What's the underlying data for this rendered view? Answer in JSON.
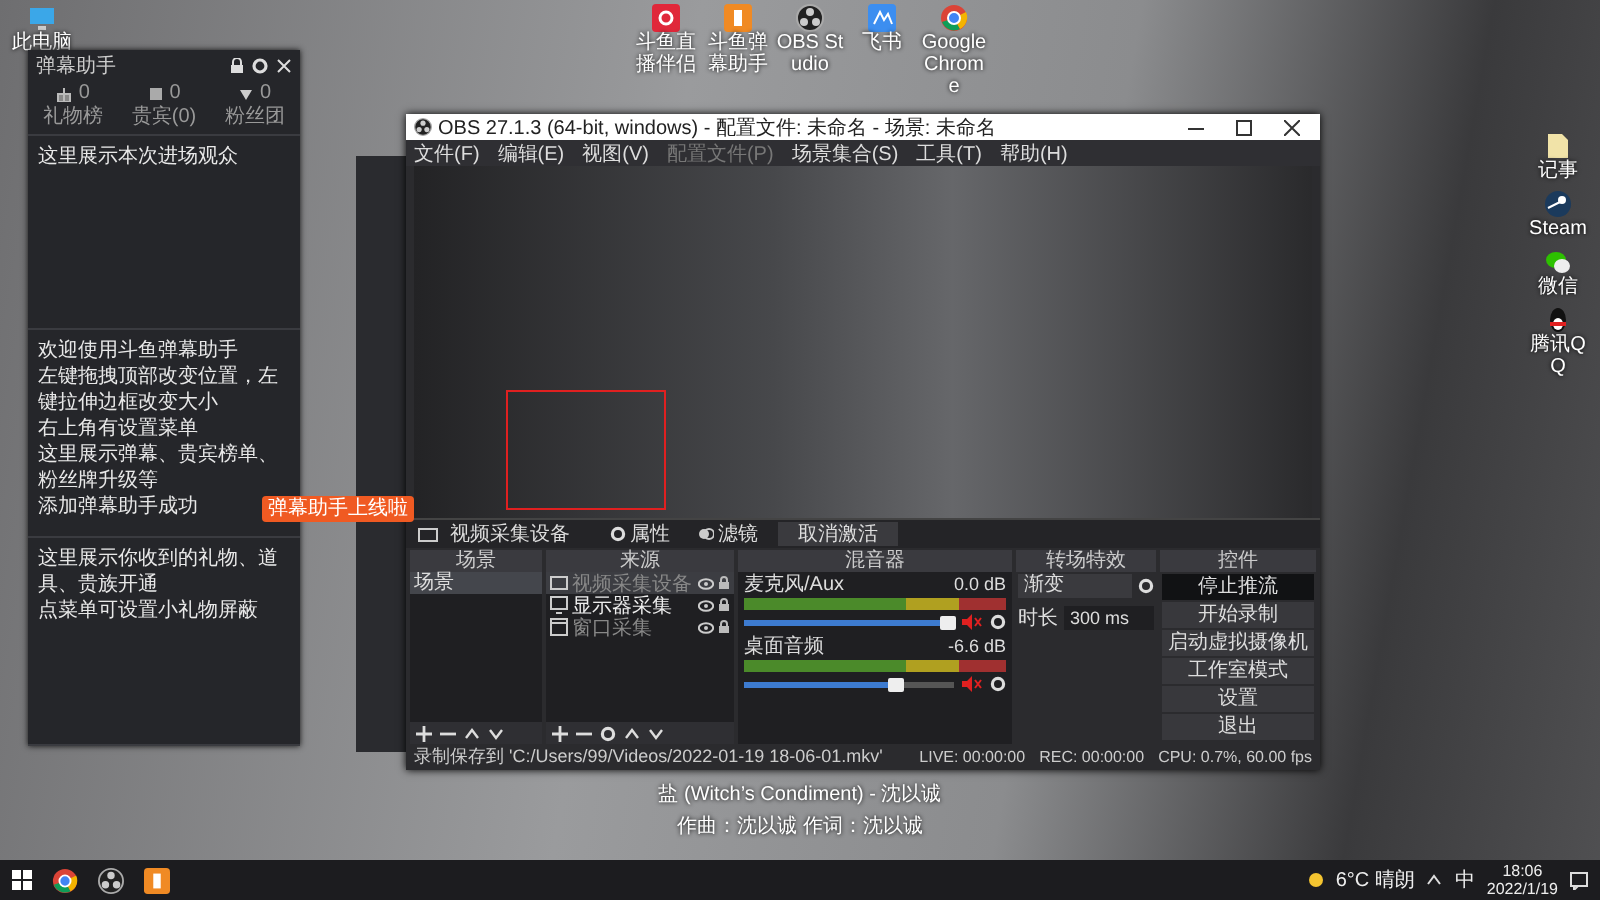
{
  "desktop": {
    "left_icons": [
      {
        "label": "此电脑",
        "kind": "pc"
      }
    ],
    "top_icons": [
      {
        "label": "斗鱼直播伴侣",
        "kind": "red"
      },
      {
        "label": "斗鱼弹幕助手",
        "kind": "orange"
      },
      {
        "label": "OBS Studio",
        "kind": "obs"
      },
      {
        "label": "飞书",
        "kind": "blue"
      },
      {
        "label": "Google Chrome",
        "kind": "chrome"
      }
    ],
    "right_icons": [
      {
        "label": "记事",
        "kind": "file"
      },
      {
        "label": "Steam",
        "kind": "steam"
      },
      {
        "label": "微信",
        "kind": "wechat"
      },
      {
        "label": "腾讯QQ",
        "kind": "qq"
      }
    ]
  },
  "helper_window": {
    "title": "弹幕助手",
    "stats": [
      {
        "count": "0",
        "label": "礼物榜"
      },
      {
        "count": "0",
        "label": "贵宾(0)"
      },
      {
        "count": "0",
        "label": "粉丝团"
      }
    ],
    "sections": [
      {
        "lines": [
          "这里展示本次进场观众"
        ]
      },
      {
        "lines": [
          "欢迎使用斗鱼弹幕助手",
          "左键拖拽顶部改变位置，左键拉伸边框改变大小",
          "右上角有设置菜单",
          "这里展示弹幕、贵宾榜单、粉丝牌升级等",
          "添加弹幕助手成功"
        ]
      },
      {
        "lines": [
          "这里展示你收到的礼物、道具、贵族开通",
          "点菜单可设置小礼物屏蔽"
        ]
      }
    ]
  },
  "tooltip": {
    "text": "弹幕助手上线啦"
  },
  "obs": {
    "title": "OBS 27.1.3 (64-bit, windows) - 配置文件: 未命名 - 场景: 未命名",
    "menu": [
      {
        "label": "文件(F)",
        "disabled": false
      },
      {
        "label": "编辑(E)",
        "disabled": false
      },
      {
        "label": "视图(V)",
        "disabled": false
      },
      {
        "label": "配置文件(P)",
        "disabled": true
      },
      {
        "label": "场景集合(S)",
        "disabled": false
      },
      {
        "label": "工具(T)",
        "disabled": false
      },
      {
        "label": "帮助(H)",
        "disabled": false
      }
    ],
    "toolbar": {
      "source": "视频采集设备",
      "buttons": [
        {
          "label": "属性",
          "kind": "gear"
        },
        {
          "label": "滤镜",
          "kind": "filter"
        },
        {
          "label": "取消激活",
          "kind": "plain"
        }
      ]
    },
    "scenes": {
      "title": "场景",
      "items": [
        {
          "name": "场景",
          "selected": true
        }
      ]
    },
    "sources": {
      "title": "来源",
      "items": [
        {
          "name": "视频采集设备",
          "kind": "camera",
          "selected": true,
          "disabled": true
        },
        {
          "name": "显示器采集",
          "kind": "display",
          "selected": false,
          "disabled": false
        },
        {
          "name": "窗口采集",
          "kind": "window",
          "selected": false,
          "disabled": true
        }
      ]
    },
    "mixer": {
      "title": "混音器",
      "channels": [
        {
          "name": "麦克风/Aux",
          "reading": "0.0 dB",
          "level": 0.97,
          "muted": true
        },
        {
          "name": "桌面音频",
          "reading": "-6.6 dB",
          "level": 0.72,
          "muted": true
        }
      ]
    },
    "transitions": {
      "title": "转场特效",
      "type": "渐变",
      "duration_label": "时长",
      "duration": "300 ms"
    },
    "controls": {
      "title": "控件",
      "buttons": [
        {
          "label": "停止推流",
          "active": true
        },
        {
          "label": "开始录制",
          "active": false
        },
        {
          "label": "启动虚拟摄像机",
          "active": false
        },
        {
          "label": "工作室模式",
          "active": false
        },
        {
          "label": "设置",
          "active": false
        },
        {
          "label": "退出",
          "active": false
        }
      ]
    },
    "status_bar": {
      "path": "录制保存到 'C:/Users/99/Videos/2022-01-19 18-06-01.mkv'",
      "live": "LIVE: 00:00:00",
      "rec": "REC: 00:00:00",
      "cpu": "CPU: 0.7%, 60.00 fps"
    }
  },
  "lyrics": [
    "盐 (Witch’s Condiment) - 沈以诚",
    "作曲：沈以诚 作词：沈以诚"
  ],
  "taskbar": {
    "apps": [
      {
        "kind": "chrome"
      },
      {
        "kind": "obs"
      },
      {
        "kind": "orange"
      }
    ],
    "weather": "6°C 晴朗",
    "ime": "中",
    "time": "18:06",
    "date": "2022/1/19"
  }
}
